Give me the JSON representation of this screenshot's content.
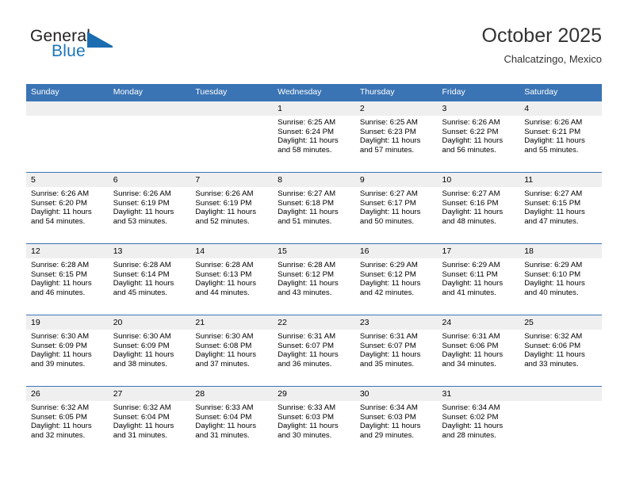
{
  "brand": {
    "name_top": "General",
    "name_bottom": "Blue",
    "accent_color": "#1b6cb0",
    "logo_icon": "triangle-flag-icon"
  },
  "header": {
    "title": "October 2025",
    "location": "Chalcatzingo, Mexico"
  },
  "theme": {
    "header_row_bg": "#3b74b4",
    "daynum_band_bg": "#efefef",
    "cell_bg": "#ffffff",
    "text_color": "#000000"
  },
  "weekday_headers": [
    "Sunday",
    "Monday",
    "Tuesday",
    "Wednesday",
    "Thursday",
    "Friday",
    "Saturday"
  ],
  "labels": {
    "sunrise_prefix": "Sunrise:",
    "sunset_prefix": "Sunset:",
    "daylight_prefix": "Daylight:"
  },
  "weeks": [
    [
      {
        "day": "",
        "sunrise": "",
        "sunset": "",
        "daylight_line1": "",
        "daylight_line2": "",
        "empty": true
      },
      {
        "day": "",
        "sunrise": "",
        "sunset": "",
        "daylight_line1": "",
        "daylight_line2": "",
        "empty": true
      },
      {
        "day": "",
        "sunrise": "",
        "sunset": "",
        "daylight_line1": "",
        "daylight_line2": "",
        "empty": true
      },
      {
        "day": "1",
        "sunrise": "Sunrise: 6:25 AM",
        "sunset": "Sunset: 6:24 PM",
        "daylight_line1": "Daylight: 11 hours",
        "daylight_line2": "and 58 minutes.",
        "empty": false
      },
      {
        "day": "2",
        "sunrise": "Sunrise: 6:25 AM",
        "sunset": "Sunset: 6:23 PM",
        "daylight_line1": "Daylight: 11 hours",
        "daylight_line2": "and 57 minutes.",
        "empty": false
      },
      {
        "day": "3",
        "sunrise": "Sunrise: 6:26 AM",
        "sunset": "Sunset: 6:22 PM",
        "daylight_line1": "Daylight: 11 hours",
        "daylight_line2": "and 56 minutes.",
        "empty": false
      },
      {
        "day": "4",
        "sunrise": "Sunrise: 6:26 AM",
        "sunset": "Sunset: 6:21 PM",
        "daylight_line1": "Daylight: 11 hours",
        "daylight_line2": "and 55 minutes.",
        "empty": false
      }
    ],
    [
      {
        "day": "5",
        "sunrise": "Sunrise: 6:26 AM",
        "sunset": "Sunset: 6:20 PM",
        "daylight_line1": "Daylight: 11 hours",
        "daylight_line2": "and 54 minutes.",
        "empty": false
      },
      {
        "day": "6",
        "sunrise": "Sunrise: 6:26 AM",
        "sunset": "Sunset: 6:19 PM",
        "daylight_line1": "Daylight: 11 hours",
        "daylight_line2": "and 53 minutes.",
        "empty": false
      },
      {
        "day": "7",
        "sunrise": "Sunrise: 6:26 AM",
        "sunset": "Sunset: 6:19 PM",
        "daylight_line1": "Daylight: 11 hours",
        "daylight_line2": "and 52 minutes.",
        "empty": false
      },
      {
        "day": "8",
        "sunrise": "Sunrise: 6:27 AM",
        "sunset": "Sunset: 6:18 PM",
        "daylight_line1": "Daylight: 11 hours",
        "daylight_line2": "and 51 minutes.",
        "empty": false
      },
      {
        "day": "9",
        "sunrise": "Sunrise: 6:27 AM",
        "sunset": "Sunset: 6:17 PM",
        "daylight_line1": "Daylight: 11 hours",
        "daylight_line2": "and 50 minutes.",
        "empty": false
      },
      {
        "day": "10",
        "sunrise": "Sunrise: 6:27 AM",
        "sunset": "Sunset: 6:16 PM",
        "daylight_line1": "Daylight: 11 hours",
        "daylight_line2": "and 48 minutes.",
        "empty": false
      },
      {
        "day": "11",
        "sunrise": "Sunrise: 6:27 AM",
        "sunset": "Sunset: 6:15 PM",
        "daylight_line1": "Daylight: 11 hours",
        "daylight_line2": "and 47 minutes.",
        "empty": false
      }
    ],
    [
      {
        "day": "12",
        "sunrise": "Sunrise: 6:28 AM",
        "sunset": "Sunset: 6:15 PM",
        "daylight_line1": "Daylight: 11 hours",
        "daylight_line2": "and 46 minutes.",
        "empty": false
      },
      {
        "day": "13",
        "sunrise": "Sunrise: 6:28 AM",
        "sunset": "Sunset: 6:14 PM",
        "daylight_line1": "Daylight: 11 hours",
        "daylight_line2": "and 45 minutes.",
        "empty": false
      },
      {
        "day": "14",
        "sunrise": "Sunrise: 6:28 AM",
        "sunset": "Sunset: 6:13 PM",
        "daylight_line1": "Daylight: 11 hours",
        "daylight_line2": "and 44 minutes.",
        "empty": false
      },
      {
        "day": "15",
        "sunrise": "Sunrise: 6:28 AM",
        "sunset": "Sunset: 6:12 PM",
        "daylight_line1": "Daylight: 11 hours",
        "daylight_line2": "and 43 minutes.",
        "empty": false
      },
      {
        "day": "16",
        "sunrise": "Sunrise: 6:29 AM",
        "sunset": "Sunset: 6:12 PM",
        "daylight_line1": "Daylight: 11 hours",
        "daylight_line2": "and 42 minutes.",
        "empty": false
      },
      {
        "day": "17",
        "sunrise": "Sunrise: 6:29 AM",
        "sunset": "Sunset: 6:11 PM",
        "daylight_line1": "Daylight: 11 hours",
        "daylight_line2": "and 41 minutes.",
        "empty": false
      },
      {
        "day": "18",
        "sunrise": "Sunrise: 6:29 AM",
        "sunset": "Sunset: 6:10 PM",
        "daylight_line1": "Daylight: 11 hours",
        "daylight_line2": "and 40 minutes.",
        "empty": false
      }
    ],
    [
      {
        "day": "19",
        "sunrise": "Sunrise: 6:30 AM",
        "sunset": "Sunset: 6:09 PM",
        "daylight_line1": "Daylight: 11 hours",
        "daylight_line2": "and 39 minutes.",
        "empty": false
      },
      {
        "day": "20",
        "sunrise": "Sunrise: 6:30 AM",
        "sunset": "Sunset: 6:09 PM",
        "daylight_line1": "Daylight: 11 hours",
        "daylight_line2": "and 38 minutes.",
        "empty": false
      },
      {
        "day": "21",
        "sunrise": "Sunrise: 6:30 AM",
        "sunset": "Sunset: 6:08 PM",
        "daylight_line1": "Daylight: 11 hours",
        "daylight_line2": "and 37 minutes.",
        "empty": false
      },
      {
        "day": "22",
        "sunrise": "Sunrise: 6:31 AM",
        "sunset": "Sunset: 6:07 PM",
        "daylight_line1": "Daylight: 11 hours",
        "daylight_line2": "and 36 minutes.",
        "empty": false
      },
      {
        "day": "23",
        "sunrise": "Sunrise: 6:31 AM",
        "sunset": "Sunset: 6:07 PM",
        "daylight_line1": "Daylight: 11 hours",
        "daylight_line2": "and 35 minutes.",
        "empty": false
      },
      {
        "day": "24",
        "sunrise": "Sunrise: 6:31 AM",
        "sunset": "Sunset: 6:06 PM",
        "daylight_line1": "Daylight: 11 hours",
        "daylight_line2": "and 34 minutes.",
        "empty": false
      },
      {
        "day": "25",
        "sunrise": "Sunrise: 6:32 AM",
        "sunset": "Sunset: 6:06 PM",
        "daylight_line1": "Daylight: 11 hours",
        "daylight_line2": "and 33 minutes.",
        "empty": false
      }
    ],
    [
      {
        "day": "26",
        "sunrise": "Sunrise: 6:32 AM",
        "sunset": "Sunset: 6:05 PM",
        "daylight_line1": "Daylight: 11 hours",
        "daylight_line2": "and 32 minutes.",
        "empty": false
      },
      {
        "day": "27",
        "sunrise": "Sunrise: 6:32 AM",
        "sunset": "Sunset: 6:04 PM",
        "daylight_line1": "Daylight: 11 hours",
        "daylight_line2": "and 31 minutes.",
        "empty": false
      },
      {
        "day": "28",
        "sunrise": "Sunrise: 6:33 AM",
        "sunset": "Sunset: 6:04 PM",
        "daylight_line1": "Daylight: 11 hours",
        "daylight_line2": "and 31 minutes.",
        "empty": false
      },
      {
        "day": "29",
        "sunrise": "Sunrise: 6:33 AM",
        "sunset": "Sunset: 6:03 PM",
        "daylight_line1": "Daylight: 11 hours",
        "daylight_line2": "and 30 minutes.",
        "empty": false
      },
      {
        "day": "30",
        "sunrise": "Sunrise: 6:34 AM",
        "sunset": "Sunset: 6:03 PM",
        "daylight_line1": "Daylight: 11 hours",
        "daylight_line2": "and 29 minutes.",
        "empty": false
      },
      {
        "day": "31",
        "sunrise": "Sunrise: 6:34 AM",
        "sunset": "Sunset: 6:02 PM",
        "daylight_line1": "Daylight: 11 hours",
        "daylight_line2": "and 28 minutes.",
        "empty": false
      },
      {
        "day": "",
        "sunrise": "",
        "sunset": "",
        "daylight_line1": "",
        "daylight_line2": "",
        "empty": true
      }
    ]
  ]
}
